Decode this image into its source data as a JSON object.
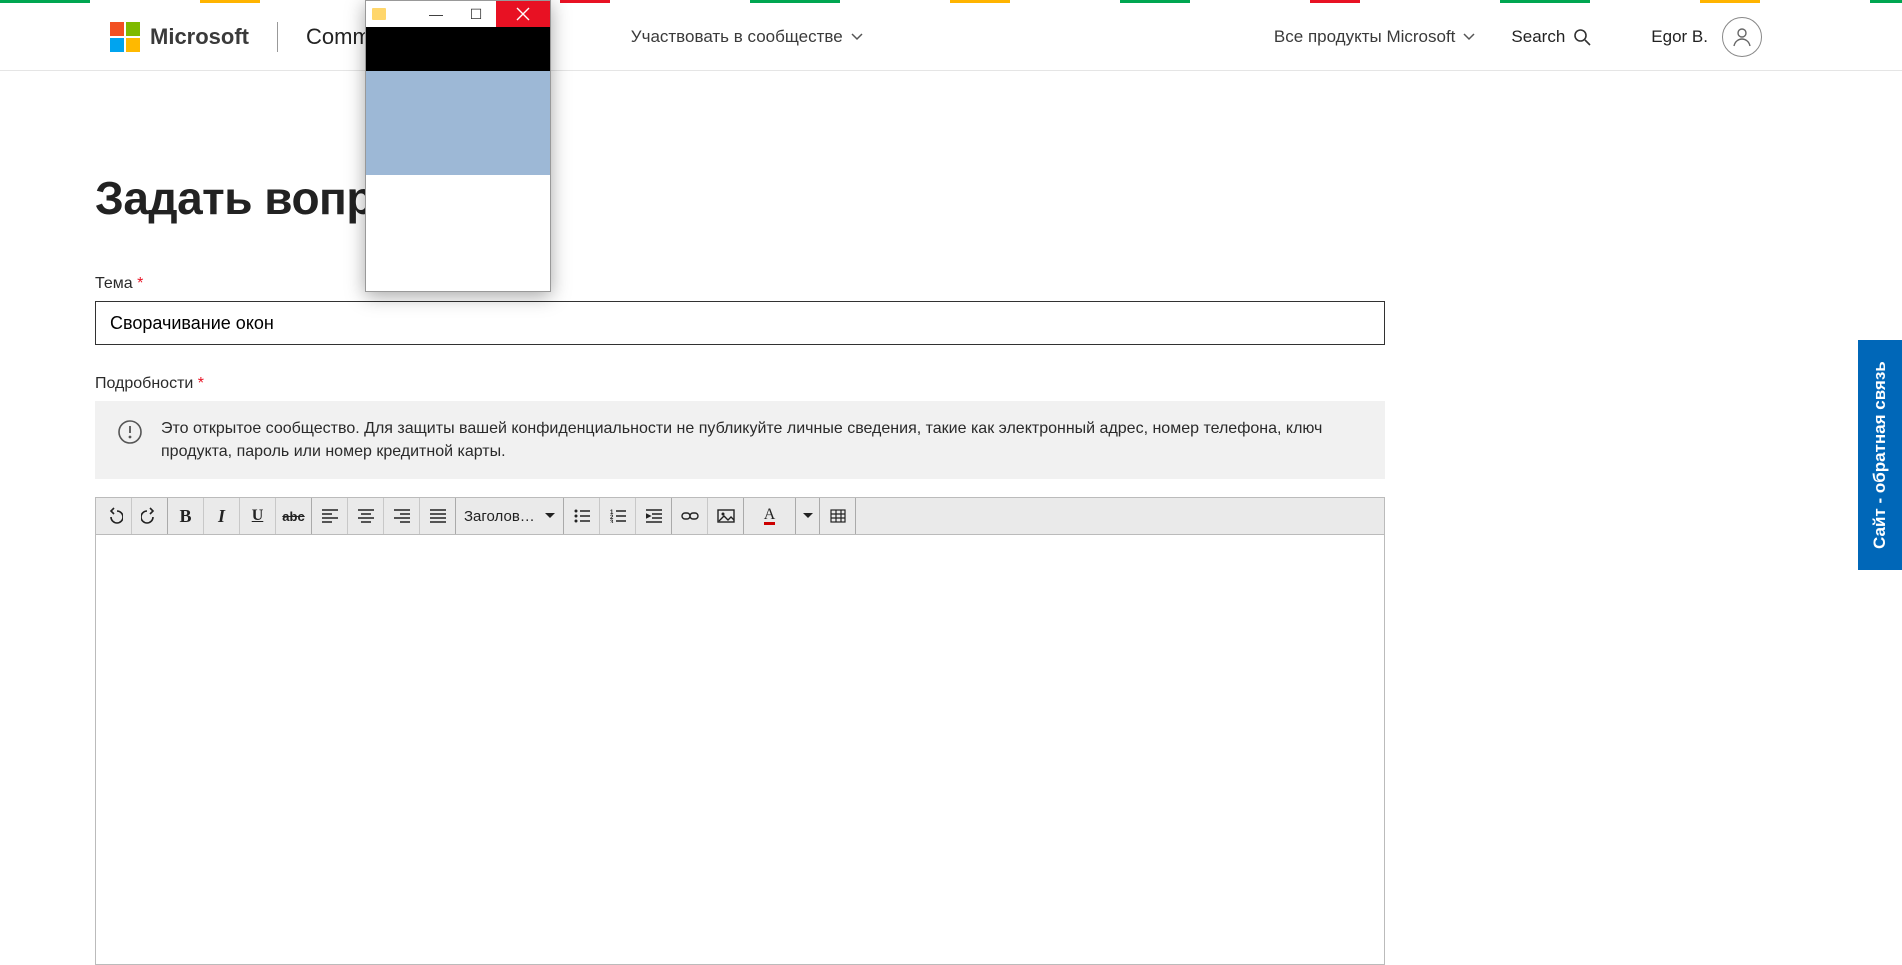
{
  "header": {
    "brand": "Microsoft",
    "community_partial": "Comm",
    "nav_participate": "Участвовать в сообществе",
    "nav_products": "Все продукты Microsoft",
    "search_label": "Search",
    "user_name": "Egor B."
  },
  "page": {
    "title": "Задать вопро",
    "subject_label": "Тема",
    "subject_value": "Сворачивание окон",
    "details_label": "Подробности",
    "notice_text": "Это открытое сообщество. Для защиты вашей конфиденциальности не публикуйте личные сведения, такие как электронный адрес, номер телефона, ключ продукта, пароль или номер кредитной карты."
  },
  "toolbar": {
    "heading_label": "Заголов…",
    "buttons": {
      "undo": "↶",
      "redo": "↷",
      "bold": "B",
      "italic": "I",
      "underline": "U",
      "strike": "abc",
      "align_left": "≡",
      "align_center": "≡",
      "align_right": "≡",
      "justify": "≡",
      "ul": "•",
      "ol": "1",
      "indent": "→",
      "link": "🔗",
      "image": "🖼",
      "font_color": "A",
      "table": "▦"
    }
  },
  "feedback_tab": "Сайт - обратная связь",
  "float_window": {
    "minimize": "—",
    "maximize": "☐",
    "close": "×"
  }
}
